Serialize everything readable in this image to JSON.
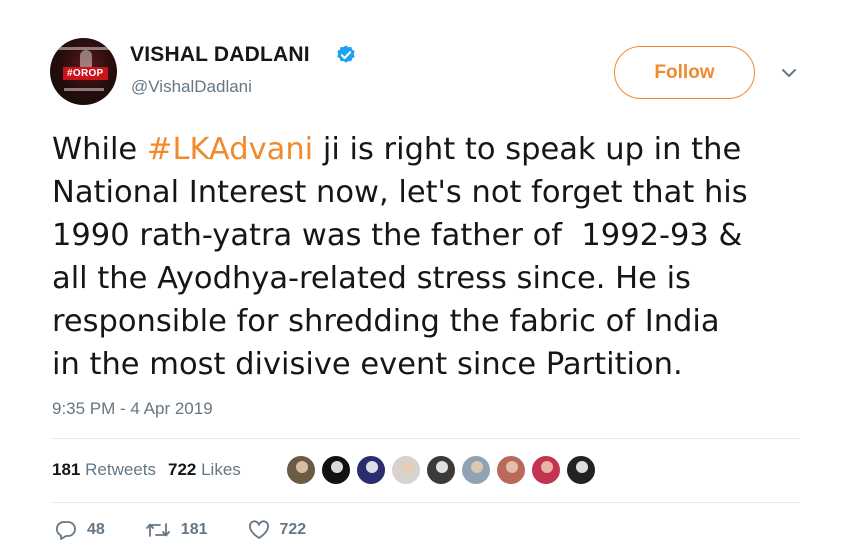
{
  "author": {
    "name": "VISHAL DADLANI",
    "handle": "@VishalDadlani",
    "avatar_badge": "#OROP",
    "verified": true,
    "verified_color": "#1da1f2"
  },
  "follow_button": {
    "label": "Follow",
    "accent": "#f08a2d"
  },
  "menu": {
    "icon": "chevron-down-icon"
  },
  "tweet": {
    "prefix": "While ",
    "hashtag": "#LKAdvani",
    "body": " ji is right to speak up in the\nNational Interest now, let's not forget that his\n1990 rath-yatra was the father of  1992-93 &\nall the Ayodhya-related stress since. He is\nresponsible for shredding the fabric of India\nin the most divisive event since Partition.",
    "hashtag_color": "#f08a2d"
  },
  "timestamp": "9:35 PM - 4 Apr 2019",
  "stats": {
    "retweets_count": "181",
    "retweets_label": "Retweets",
    "likes_count": "722",
    "likes_label": "Likes"
  },
  "liked_by_avatars": [
    {
      "color": "#6b5a44"
    },
    {
      "color": "#111111"
    },
    {
      "color": "#2b2d6e"
    },
    {
      "color": "#d7d2cc"
    },
    {
      "color": "#3a3a3a"
    },
    {
      "color": "#8fa3b5"
    },
    {
      "color": "#b86a5a"
    },
    {
      "color": "#c2344f"
    },
    {
      "color": "#222222"
    }
  ],
  "actions": {
    "reply_count": "48",
    "retweet_count": "181",
    "like_count": "722"
  }
}
